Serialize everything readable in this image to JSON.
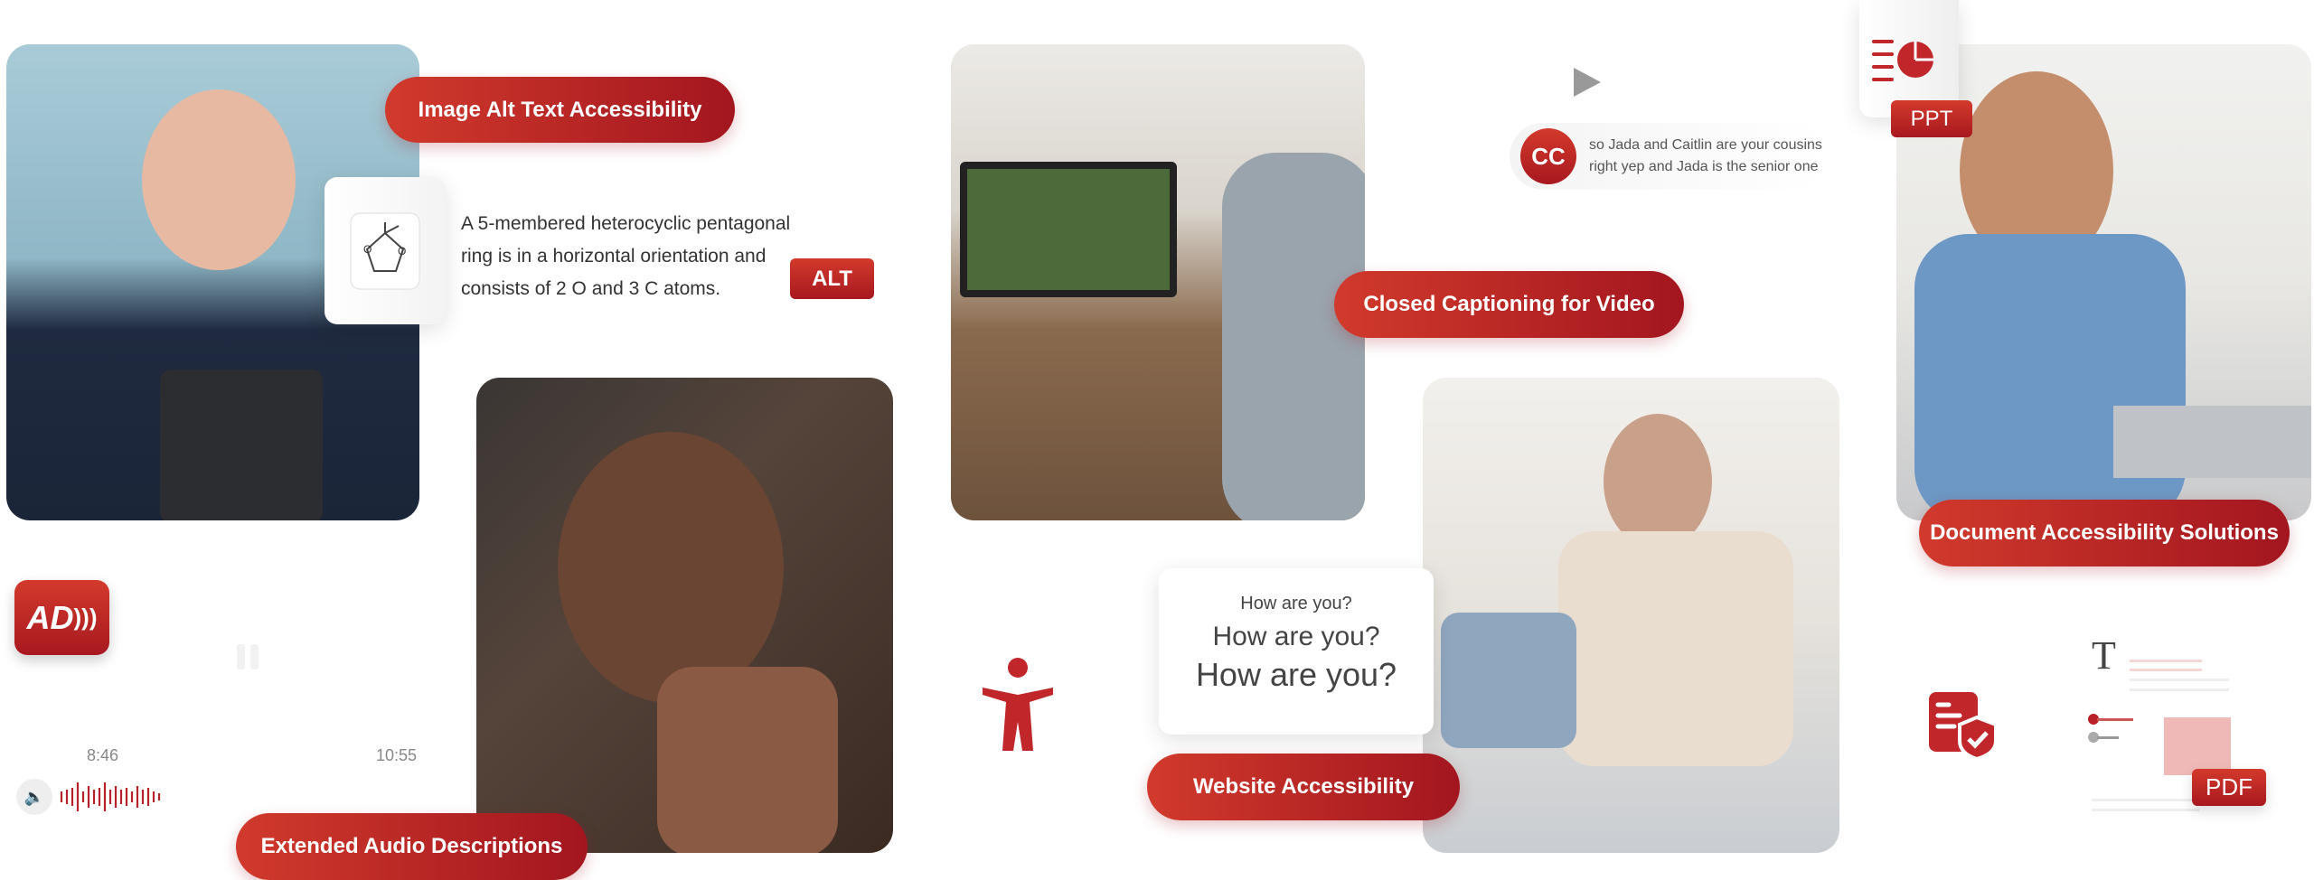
{
  "colors": {
    "accent": "#b8202a",
    "accent_light": "#d33a2c"
  },
  "features": {
    "alt_text": {
      "label": "Image Alt Text Accessibility",
      "description_lines": [
        "A 5-membered heterocyclic pentagonal",
        "ring is in a horizontal orientation and",
        "consists of 2 O and 3 C atoms."
      ],
      "badge": "ALT",
      "icon": "molecule-icon"
    },
    "audio": {
      "label": "Extended Audio Descriptions",
      "badge_icon": "audio-description-icon",
      "badge": "AD",
      "time_current": "8:46",
      "time_total": "10:55"
    },
    "captions": {
      "label": "Closed Captioning for Video",
      "badge": "CC",
      "caption_lines": [
        "so Jada and Caitlin are your cousins",
        "right yep and Jada is the senior one"
      ]
    },
    "website": {
      "label": "Website Accessibility",
      "text_sizes": [
        "How are you?",
        "How are you?",
        "How are you?"
      ]
    },
    "documents": {
      "label": "Document Accessibility Solutions",
      "ppt_badge": "PPT",
      "pdf_badge": "PDF",
      "glyph": "T"
    }
  }
}
